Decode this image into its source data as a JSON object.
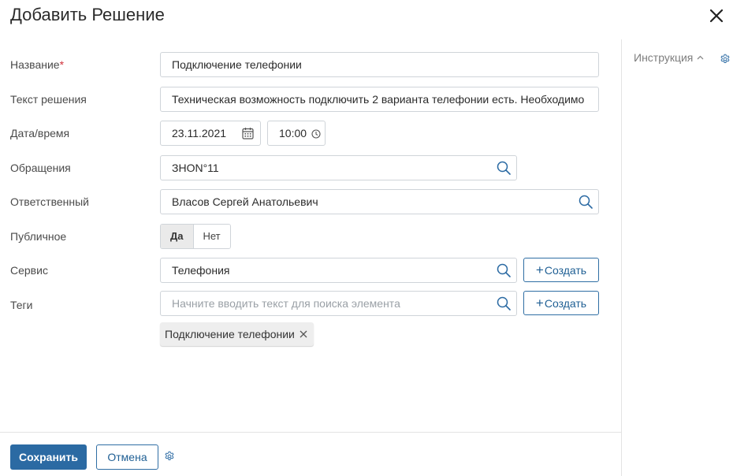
{
  "modal": {
    "title": "Добавить Решение"
  },
  "sidebar": {
    "instruction_label": "Инструкция"
  },
  "form": {
    "name": {
      "label": "Название",
      "required_mark": "*",
      "value": "Подключение телефонии"
    },
    "solution_text": {
      "label": "Текст решения",
      "value": "Техническая возможность подключить 2 варианта телефонии есть. Необходимо разе"
    },
    "datetime": {
      "label": "Дата/время",
      "date": "23.11.2021",
      "time": "10:00"
    },
    "requests": {
      "label": "Обращения",
      "value": "ЗHON°11"
    },
    "responsible": {
      "label": "Ответственный",
      "value": "Власов Сергей Анатольевич"
    },
    "public": {
      "label": "Публичное",
      "yes": "Да",
      "no": "Нет",
      "selected": "Да"
    },
    "service": {
      "label": "Сервис",
      "value": "Телефония",
      "create_label": "Создать"
    },
    "tags": {
      "label": "Теги",
      "placeholder": "Начните вводить текст для поиска элемента",
      "create_label": "Создать",
      "chips": [
        "Подключение телефонии"
      ]
    }
  },
  "footer": {
    "save_label": "Сохранить",
    "cancel_label": "Отмена"
  },
  "icons": {
    "close": "close-icon",
    "search": "search-icon",
    "calendar": "calendar-icon",
    "clock": "clock-icon",
    "gear": "gear-icon",
    "chevron": "chevron-up-icon",
    "plus": "plus-icon"
  },
  "colors": {
    "primary": "#2b6aa3",
    "required": "#d0323c",
    "search_icon": "#2b6aa3"
  }
}
